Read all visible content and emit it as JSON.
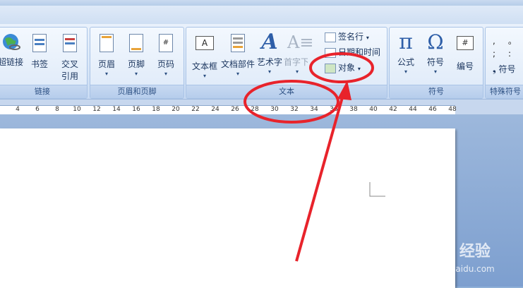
{
  "ribbon": {
    "groups": {
      "links": "链接",
      "header_footer": "页眉和页脚",
      "text": "文本",
      "symbols": "符号",
      "special_symbols": "特殊符号"
    },
    "buttons": {
      "hyperlink": "超链接",
      "bookmark": "书签",
      "cross_ref_1": "交叉",
      "cross_ref_2": "引用",
      "header": "页眉",
      "footer": "页脚",
      "page_number": "页码",
      "textbox": "文本框",
      "quick_parts": "文档部件",
      "wordart": "艺术字",
      "dropcap": "首字下沉",
      "signature_line": "签名行",
      "date_time": "日期和时间",
      "object": "对象",
      "equation": "公式",
      "symbol": "符号",
      "numbering": "编号",
      "special_symbol": "符号"
    },
    "caret": "▾"
  },
  "ruler": {
    "ticks": [
      "4",
      "6",
      "8",
      "10",
      "12",
      "14",
      "16",
      "18",
      "20",
      "22",
      "24",
      "26",
      "28",
      "30",
      "32",
      "34",
      "36",
      "38",
      "40",
      "42",
      "44",
      "46",
      "48"
    ]
  },
  "watermark": {
    "brand": "Bai du 经验",
    "url": "jingyan.baidu.com"
  },
  "colors": {
    "annotation": "#e8232b",
    "ribbon_bg": "#dbe7f7"
  }
}
